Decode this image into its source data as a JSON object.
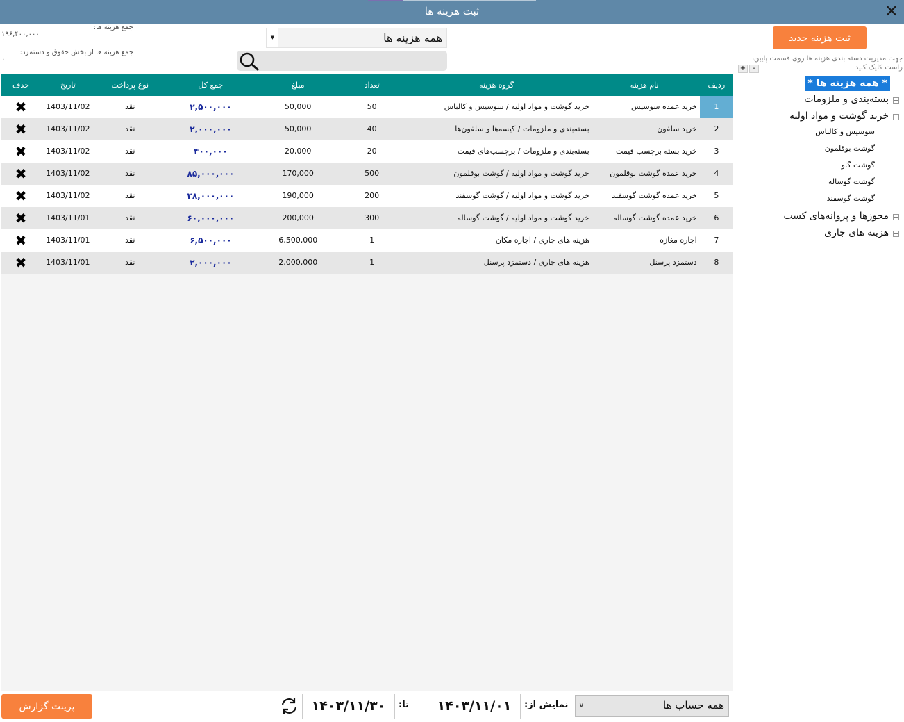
{
  "window": {
    "title": "ثبت هزینه ها",
    "close_glyph": "✕"
  },
  "totals": {
    "sum_label": "جمع هزینه ها:",
    "sum_value": "۱۹۶,۴۰۰,۰۰۰",
    "salary_label": "جمع هزینه ها از بخش حقوق و دستمزد:",
    "salary_value": "۰"
  },
  "filter": {
    "selected": "همه هزینه ها",
    "search_placeholder": ""
  },
  "table": {
    "headers": {
      "idx": "ردیف",
      "name": "نام هزینه",
      "group": "گروه هزینه",
      "qty": "تعداد",
      "amount": "مبلغ",
      "total": "جمع کل",
      "pay": "نوع پرداخت",
      "date": "تاریخ",
      "del": "حذف"
    },
    "rows": [
      {
        "idx": "1",
        "name": "خرید عمده سوسیس",
        "group": "خرید گوشت و مواد اولیه / سوسیس و کالباس",
        "qty": "50",
        "amount": "50,000",
        "total": "۲,۵۰۰,۰۰۰",
        "pay": "نقد",
        "date": "1403/11/02"
      },
      {
        "idx": "2",
        "name": "خرید سلفون",
        "group": "بسته‌بندی و ملزومات / کیسه‌ها و سلفون‌ها",
        "qty": "40",
        "amount": "50,000",
        "total": "۲,۰۰۰,۰۰۰",
        "pay": "نقد",
        "date": "1403/11/02"
      },
      {
        "idx": "3",
        "name": "خرید بسته برچسب قیمت",
        "group": "بسته‌بندی و ملزومات / برچسب‌های قیمت",
        "qty": "20",
        "amount": "20,000",
        "total": "۴۰۰,۰۰۰",
        "pay": "نقد",
        "date": "1403/11/02"
      },
      {
        "idx": "4",
        "name": "خرید عمده گوشت بوقلمون",
        "group": "خرید گوشت و مواد اولیه / گوشت بوقلمون",
        "qty": "500",
        "amount": "170,000",
        "total": "۸۵,۰۰۰,۰۰۰",
        "pay": "نقد",
        "date": "1403/11/02"
      },
      {
        "idx": "5",
        "name": "خرید عمده گوشت گوسفند",
        "group": "خرید گوشت و مواد اولیه / گوشت گوسفند",
        "qty": "200",
        "amount": "190,000",
        "total": "۳۸,۰۰۰,۰۰۰",
        "pay": "نقد",
        "date": "1403/11/02"
      },
      {
        "idx": "6",
        "name": "خرید عمده گوشت گوساله",
        "group": "خرید گوشت و مواد اولیه / گوشت گوساله",
        "qty": "300",
        "amount": "200,000",
        "total": "۶۰,۰۰۰,۰۰۰",
        "pay": "نقد",
        "date": "1403/11/01"
      },
      {
        "idx": "7",
        "name": "اجاره مغازه",
        "group": "هزینه های جاری / اجاره مکان",
        "qty": "1",
        "amount": "6,500,000",
        "total": "۶,۵۰۰,۰۰۰",
        "pay": "نقد",
        "date": "1403/11/01"
      },
      {
        "idx": "8",
        "name": "دستمزد پرسنل",
        "group": "هزینه های جاری / دستمزد پرسنل",
        "qty": "1",
        "amount": "2,000,000",
        "total": "۲,۰۰۰,۰۰۰",
        "pay": "نقد",
        "date": "1403/11/01"
      }
    ],
    "delete_glyph": "✖"
  },
  "sidebar": {
    "new_button": "ثبت هزینه جدید",
    "hint": "جهت مدیریت دسته بندی هزینه ها روی قسمت پایین، راست کلیک کنید",
    "plus": "+",
    "minus": "-",
    "tree": {
      "root": "* همه هزینه ها *",
      "packaging": "بسته‌بندی و ملزومات",
      "meat": "خرید گوشت و مواد اولیه",
      "meat_children": [
        "سوسیس و کالباس",
        "گوشت بوقلمون",
        "گوشت گاو",
        "گوشت گوساله",
        "گوشت گوسفند"
      ],
      "licenses": "مجوزها و پروانه‌های کسب",
      "running": "هزینه های جاری"
    }
  },
  "footer": {
    "print_button": "پرینت گزارش",
    "to_label": "تا:",
    "to_date": "۱۴۰۳/۱۱/۳۰",
    "from_label": "نمایش از:",
    "from_date": "۱۴۰۳/۱۱/۰۱",
    "account_selected": "همه حساب ها"
  },
  "colors": {
    "titlebar": "#5f88a8",
    "header": "#008a88",
    "accent": "#f8813d",
    "total_text": "#1a2a9c",
    "tree_selected": "#1a7cdb"
  }
}
